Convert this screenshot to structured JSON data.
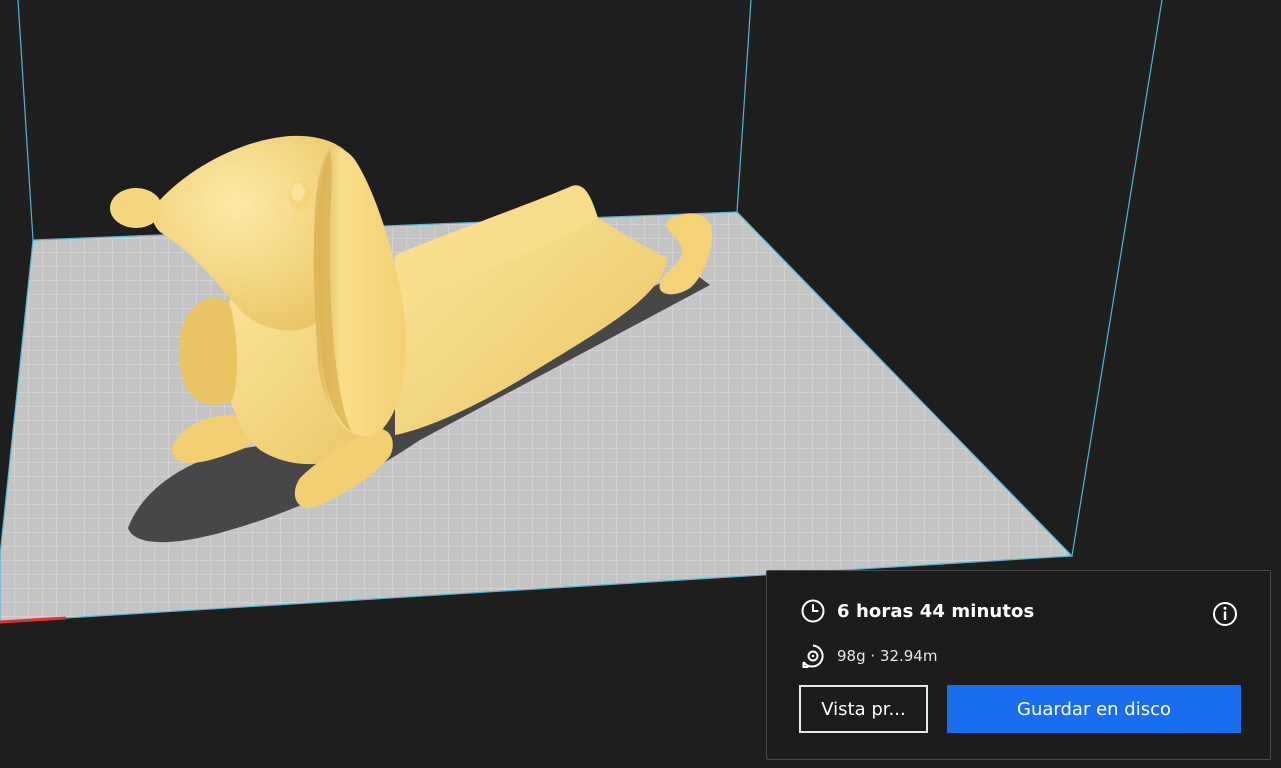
{
  "viewport": {
    "model": "dachshund-phone-stand",
    "model_color": "#f7d77f",
    "build_plate_color": "#c4c4c4",
    "volume_edge_color": "#4fb4d8",
    "background_color": "#1e1e1e"
  },
  "print_summary": {
    "time_icon": "clock-icon",
    "print_time": "6 horas 44 minutos",
    "material_icon": "filament-spool-icon",
    "material_usage": "98g · 32.94m",
    "info_icon": "info-icon"
  },
  "actions": {
    "preview_label": "Vista pr...",
    "save_label": "Guardar en disco",
    "save_color": "#196ef0"
  }
}
